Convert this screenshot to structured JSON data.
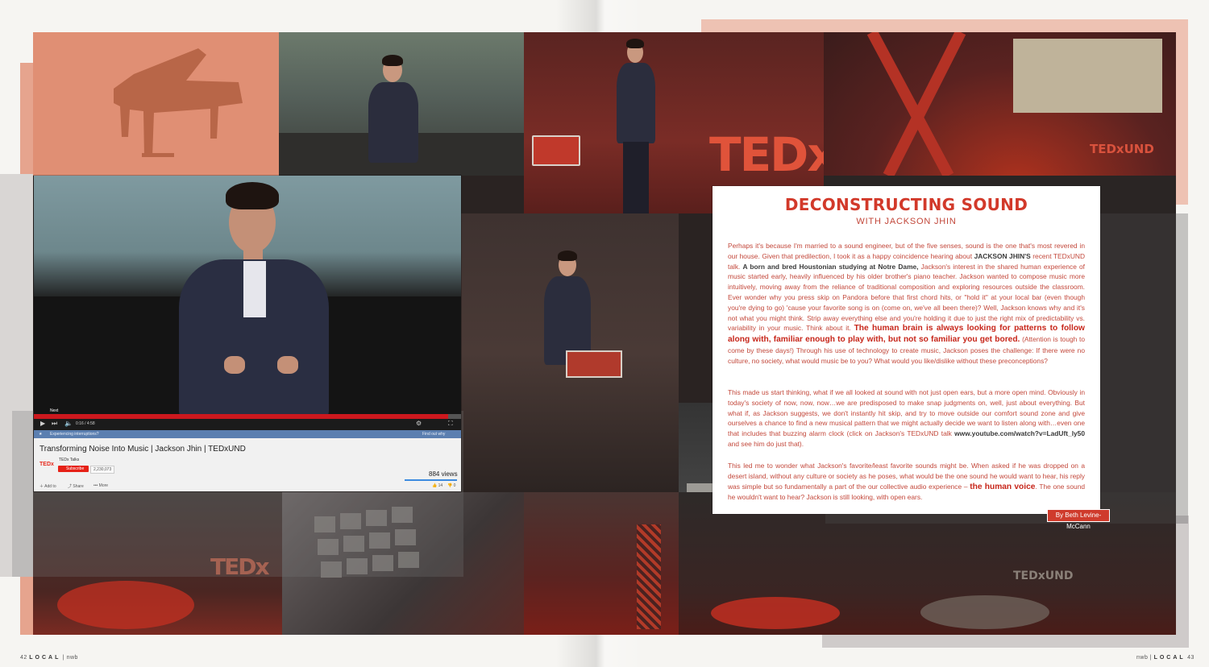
{
  "video": {
    "title": "Transforming Noise Into Music | Jackson Jhin | TEDxUND",
    "channel": "TEDx Talks",
    "subscribe": "Subscribe",
    "subscribers": "2,230,073",
    "views": "884 views",
    "notification": "Experiencing interruptions?",
    "notification_link": "Find out why",
    "add_to": "Add to",
    "share": "Share",
    "more": "More",
    "time": "0:16 / 4:58",
    "tooltip": "Next",
    "likes": "14",
    "dislikes": "0",
    "progress_fraction": 0.97,
    "logo": "TEDx"
  },
  "article": {
    "title": "DECONSTRUCTING SOUND",
    "subtitle": "WITH JACKSON JHIN",
    "p1_a": "Perhaps it's because I'm married to a sound engineer, but of the five senses, sound is the one that's most revered in our house. Given that predilection, I took it as a happy coincidence hearing about ",
    "p1_name": "JACKSON JHIN'S",
    "p1_b": " recent TEDxUND talk. ",
    "p1_c": "A born and bred Houstonian studying at Notre Dame,",
    "p1_d": " Jackson's interest in the shared human experience of music started early, heavily influenced by his older brother's piano teacher. Jackson wanted to compose music more intuitively, moving away from the reliance of traditional composition and exploring resources outside the classroom. Ever wonder why you press skip on Pandora before that first chord hits, or \"hold it\" at your local bar (even though you're dying to go) 'cause your favorite song is on (come on, we've all been there)? Well, Jackson knows why and it's not what you might think. Strip away everything else and you're holding it due to just the right mix of predictability vs. variability in your music. Think about it. ",
    "p1_hl": "The human brain is always looking for patterns to follow along with, familiar enough to play with, but not so familiar you get bored.",
    "p1_e": " (Attention is tough to come by these days!) Through his use of technology to create music, Jackson poses the challenge: If there were no culture, no society, what would music be to you? What would you like/dislike without these preconceptions?",
    "p2_a": "This made us start thinking, what if we all looked at sound with not just open ears, but a more open mind. Obviously in today's society of now, now, now…we are predisposed to make snap judgments on, well, just about everything. But what if, as Jackson suggests, we don't instantly hit skip, and try to move outside our comfort sound zone and give ourselves a chance to find a new musical pattern that we might actually decide we want to listen along with…even one that includes that buzzing alarm clock (click on Jackson's TEDxUND talk ",
    "p2_url": "www.youtube.com/watch?v=LadUft_ly50",
    "p2_b": " and see him do just that).",
    "p3_a": "This led me to wonder what Jackson's favorite/least favorite sounds might be. When asked if he was dropped on a desert island, without any culture or society as he poses, what would be the one sound he would want to hear, his reply was simple but so fundamentally a part of the our collective audio experience – ",
    "p3_hl": "the human voice",
    "p3_b": ". The one sound he wouldn't want to hear? Jackson is still looking, with open ears.",
    "byline": "By Beth Levine-McCann"
  },
  "folio": {
    "left_num": "42",
    "left_mag": "LOCAL",
    "left_issue": "nwb",
    "right_issue": "nwb",
    "right_mag": "LOCAL",
    "right_num": "43"
  },
  "stage": {
    "ted_big": "TEDx",
    "ted_und": "TEDxUND"
  },
  "colors": {
    "accent": "#d2392a",
    "salmon": "#e2967b",
    "dark_overlay": "#2a2322"
  }
}
